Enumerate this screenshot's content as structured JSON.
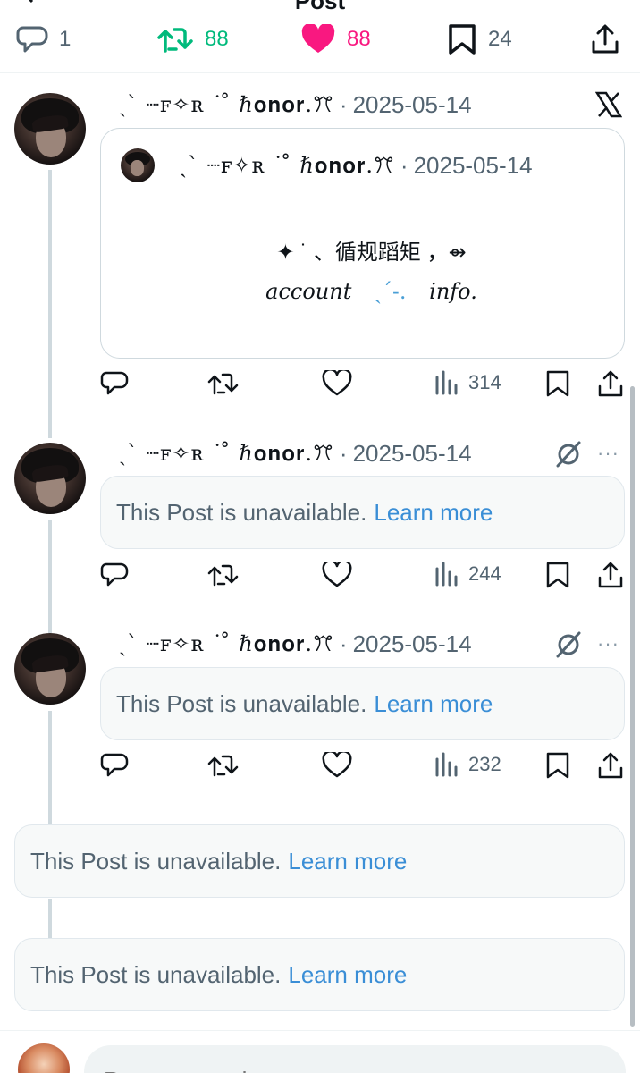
{
  "header": {
    "title": "Post"
  },
  "main_stats": {
    "replies": "1",
    "reposts": "88",
    "likes": "88",
    "bookmarks": "24"
  },
  "colors": {
    "repost_green": "#00ba7c",
    "like_pink": "#f91880",
    "link_blue": "#3a8ed6",
    "muted": "#536471"
  },
  "tweets": [
    {
      "author": "ˎˋ ┈ꜰ✧ʀ ˙ ̊ ℏ𝐨𝐧𝐨𝐫.ꔫ",
      "date": "2025-05-14",
      "quote": {
        "author": "ˎˋ ┈ꜰ✧ʀ ˙ ̊ ℏ𝐨𝐧𝐨𝐫.ꔫ",
        "date": "2025-05-14",
        "line1": "✦ ˙ 、循规蹈矩 ，⇴",
        "line2_a": "account",
        "line2_b": "ˎˊ˗.",
        "line2_c": "info."
      },
      "views": "314"
    },
    {
      "author": "ˎˋ ┈ꜰ✧ʀ ˙ ̊ ℏ𝐨𝐧𝐨𝐫.ꔫ",
      "date": "2025-05-14",
      "unavailable_text": "This Post is unavailable.",
      "learn_more": "Learn more",
      "views": "244"
    },
    {
      "author": "ˎˋ ┈ꜰ✧ʀ ˙ ̊ ℏ𝐨𝐧𝐨𝐫.ꔫ",
      "date": "2025-05-14",
      "unavailable_text": "This Post is unavailable.",
      "learn_more": "Learn more",
      "views": "232"
    }
  ],
  "unavailable_posts": [
    {
      "text": "This Post is unavailable.",
      "learn_more": "Learn more"
    },
    {
      "text": "This Post is unavailable.",
      "learn_more": "Learn more"
    }
  ],
  "separator": "·",
  "more_label": "···",
  "reply": {
    "placeholder": "Post your reply"
  }
}
